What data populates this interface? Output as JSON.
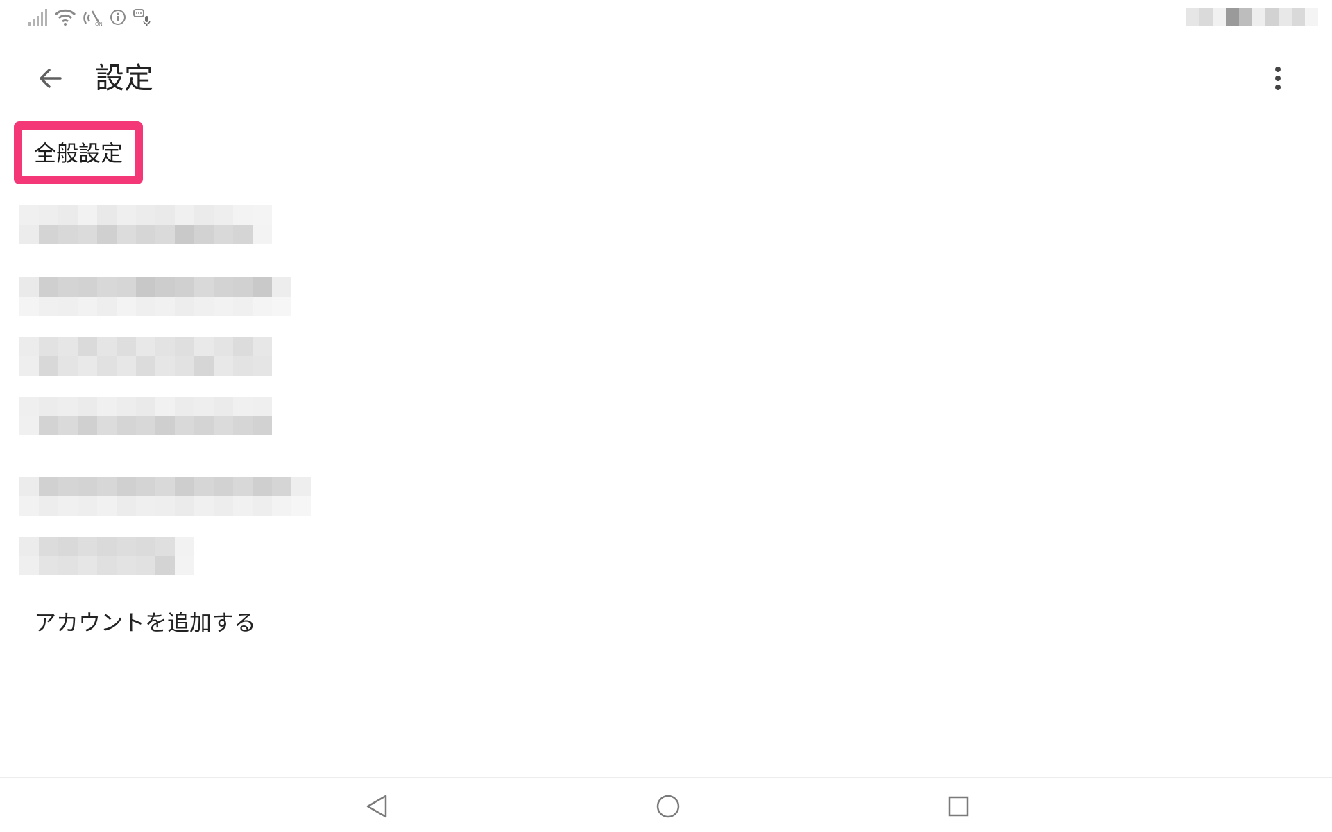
{
  "status_bar": {
    "icons": [
      "signal-icon",
      "wifi-icon",
      "nfc-icon",
      "info-icon",
      "voice-message-icon"
    ]
  },
  "header": {
    "title": "設定",
    "back_icon": "arrow-back-icon",
    "overflow_icon": "more-vert-icon"
  },
  "sections": {
    "general_settings_label": "全般設定",
    "highlight_color": "#f33777"
  },
  "accounts": {
    "obscured": true
  },
  "actions": {
    "add_account_label": "アカウントを追加する"
  },
  "nav_bar": {
    "icons": [
      "nav-back-icon",
      "nav-home-icon",
      "nav-recents-icon"
    ]
  }
}
